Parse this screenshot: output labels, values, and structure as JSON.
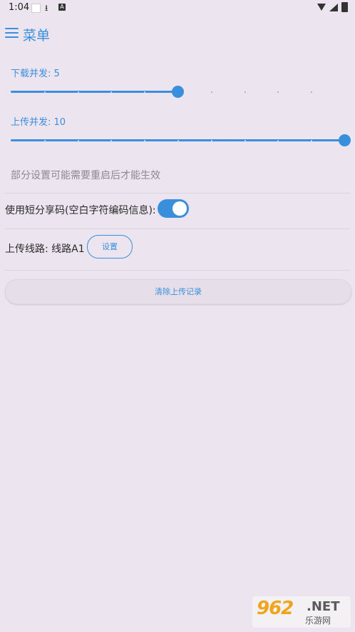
{
  "status_bar": {
    "time": "1:04"
  },
  "app_bar": {
    "title": "菜单",
    "menu_icon": "hamburger-menu-icon"
  },
  "download_concurrency": {
    "label": "下载并发: 5",
    "value": 5,
    "min": 0,
    "max": 10
  },
  "upload_concurrency": {
    "label": "上传并发: 10",
    "value": 10,
    "min": 0,
    "max": 10
  },
  "hint": "部分设置可能需要重启后才能生效",
  "short_share_code": {
    "label": "使用短分享码(空白字符编码信息):",
    "enabled": true
  },
  "upload_route": {
    "label": "上传线路: 线路A1",
    "button_label": "设置"
  },
  "clear_button": {
    "label": "清除上传记录"
  },
  "watermark": {
    "logo": "962",
    "suffix": ".NET",
    "sub": "乐游网"
  },
  "colors": {
    "accent": "#3a8fdd",
    "background": "#ece4ef",
    "hint": "#8c8a90"
  }
}
